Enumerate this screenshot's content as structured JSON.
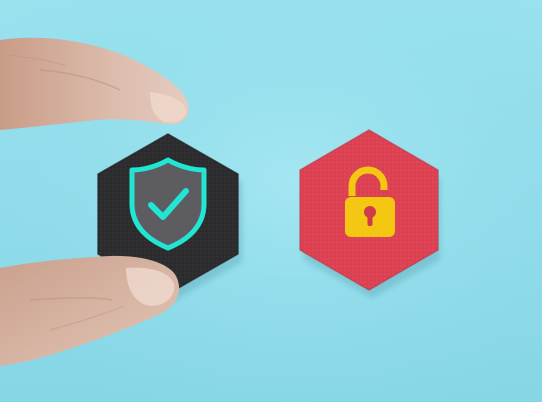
{
  "scene": {
    "subject": "security-vs-vulnerability-concept",
    "background_color": "#8fdcea",
    "left_tile": {
      "icon": "shield-check-icon",
      "tile_color": "#2b2b2d",
      "icon_color": "#22e6d4"
    },
    "right_tile": {
      "icon": "unlocked-padlock-icon",
      "tile_color": "#dc3f50",
      "icon_color": "#f3c712"
    },
    "hand_color": "#d9b8a8"
  }
}
